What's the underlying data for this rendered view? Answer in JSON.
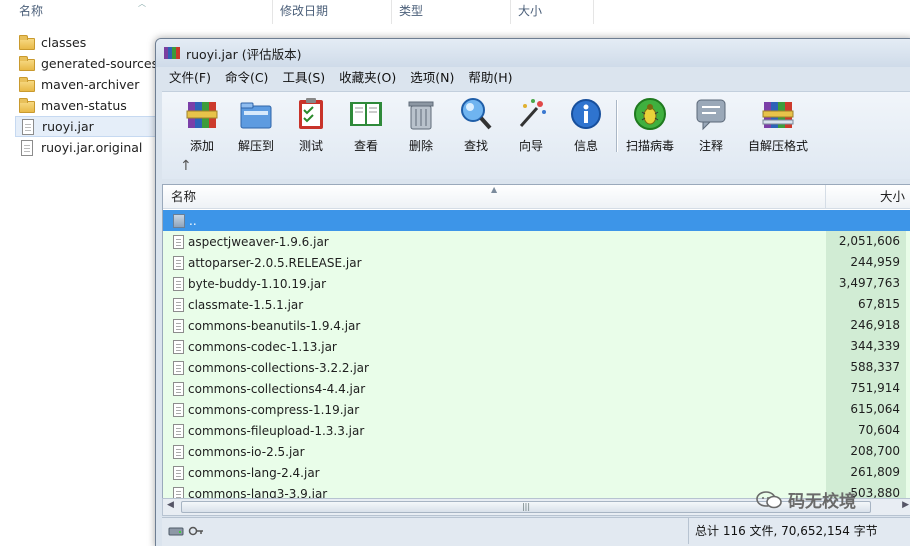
{
  "explorer": {
    "columns": {
      "name": "名称",
      "date": "修改日期",
      "type": "类型",
      "size": "大小"
    },
    "items": [
      {
        "label": "classes",
        "kind": "folder"
      },
      {
        "label": "generated-sources",
        "kind": "folder"
      },
      {
        "label": "maven-archiver",
        "kind": "folder"
      },
      {
        "label": "maven-status",
        "kind": "folder"
      },
      {
        "label": "ruoyi.jar",
        "kind": "file"
      },
      {
        "label": "ruoyi.jar.original",
        "kind": "file"
      }
    ]
  },
  "winrar": {
    "title": "ruoyi.jar (评估版本)",
    "menu": [
      "文件(F)",
      "命令(C)",
      "工具(S)",
      "收藏夹(O)",
      "选项(N)",
      "帮助(H)"
    ],
    "toolbar": [
      {
        "label": "添加",
        "icon": "books-add-icon"
      },
      {
        "label": "解压到",
        "icon": "folder-extract-icon"
      },
      {
        "label": "测试",
        "icon": "clipboard-check-icon"
      },
      {
        "label": "查看",
        "icon": "book-view-icon"
      },
      {
        "label": "删除",
        "icon": "trash-icon"
      },
      {
        "label": "查找",
        "icon": "magnifier-icon"
      },
      {
        "label": "向导",
        "icon": "wand-icon"
      },
      {
        "label": "信息",
        "icon": "info-icon"
      },
      {
        "label": "扫描病毒",
        "icon": "bug-scan-icon"
      },
      {
        "label": "注释",
        "icon": "comment-icon"
      },
      {
        "label": "自解压格式",
        "icon": "sfx-icon"
      }
    ],
    "list": {
      "header_name": "名称",
      "header_size": "大小",
      "parent": "..",
      "rows": [
        {
          "name": "aspectjweaver-1.9.6.jar",
          "size": "2,051,606"
        },
        {
          "name": "attoparser-2.0.5.RELEASE.jar",
          "size": "244,959"
        },
        {
          "name": "byte-buddy-1.10.19.jar",
          "size": "3,497,763"
        },
        {
          "name": "classmate-1.5.1.jar",
          "size": "67,815"
        },
        {
          "name": "commons-beanutils-1.9.4.jar",
          "size": "246,918"
        },
        {
          "name": "commons-codec-1.13.jar",
          "size": "344,339"
        },
        {
          "name": "commons-collections-3.2.2.jar",
          "size": "588,337"
        },
        {
          "name": "commons-collections4-4.4.jar",
          "size": "751,914"
        },
        {
          "name": "commons-compress-1.19.jar",
          "size": "615,064"
        },
        {
          "name": "commons-fileupload-1.3.3.jar",
          "size": "70,604"
        },
        {
          "name": "commons-io-2.5.jar",
          "size": "208,700"
        },
        {
          "name": "commons-lang-2.4.jar",
          "size": "261,809"
        },
        {
          "name": "commons-lang3-3.9.jar",
          "size": "503,880"
        }
      ]
    },
    "status": "总计 116 文件, 70,652,154 字节"
  },
  "watermark": "码无校境",
  "colors": {
    "selected_row": "#3d95e8",
    "row_bg": "#e9fde9",
    "size_col_bg": "#d1ecd4"
  }
}
